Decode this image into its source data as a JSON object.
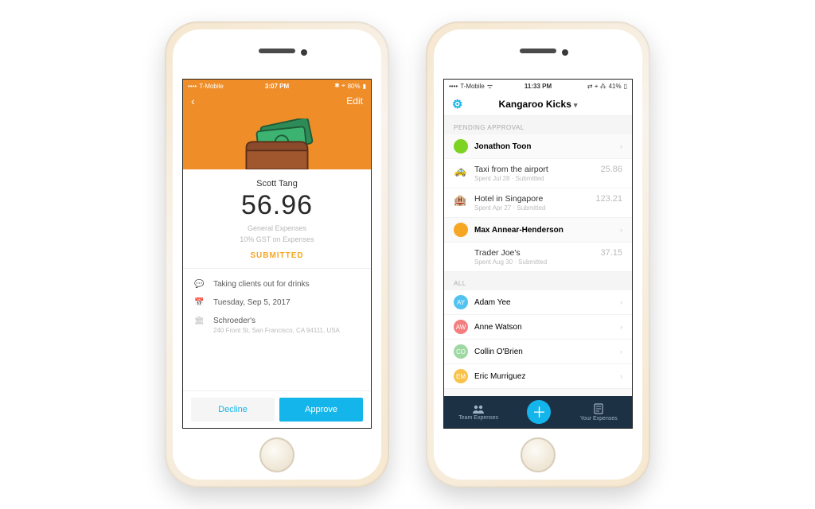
{
  "colors": {
    "accent": "#13b5ea",
    "header": "#ef8d29",
    "tabbar": "#1d3145",
    "warn": "#f5a623"
  },
  "phone1": {
    "status": {
      "carrier": "T-Mobile",
      "time": "3:07 PM",
      "battery": "80%"
    },
    "nav": {
      "edit": "Edit"
    },
    "amount": {
      "name": "Scott Tang",
      "value": "56.96",
      "category": "General Expenses",
      "gst": "10% GST on Expenses",
      "status": "SUBMITTED"
    },
    "details": {
      "note": "Taking clients out for drinks",
      "date": "Tuesday, Sep 5, 2017",
      "location_name": "Schroeder's",
      "location_addr": "240 Front St, San Francisco, CA 94111, USA"
    },
    "actions": {
      "decline": "Decline",
      "approve": "Approve"
    }
  },
  "phone2": {
    "status": {
      "carrier": "T-Mobile",
      "time": "11:33 PM",
      "battery": "41%"
    },
    "nav": {
      "title": "Kangaroo Kicks"
    },
    "sections": {
      "pending_hdr": "PENDING APPROVAL",
      "all_hdr": "ALL"
    },
    "pending": [
      {
        "name": "Jonathon Toon",
        "avatar_bg": "#7ed321"
      }
    ],
    "expenses": [
      {
        "icon": "taxi",
        "title": "Taxi from the airport",
        "meta": "Spent Jul 28 · Submitted",
        "amount": "25.86"
      },
      {
        "icon": "hotel",
        "title": "Hotel in Singapore",
        "meta": "Spent Apr 27 · Submitted",
        "amount": "123.21"
      }
    ],
    "pending2": [
      {
        "name": "Max Annear-Henderson",
        "avatar_bg": "#f6a623"
      }
    ],
    "expenses2": [
      {
        "icon": "",
        "title": "Trader Joe's",
        "meta": "Spent Aug 30 · Submitted",
        "amount": "37.15"
      }
    ],
    "all": [
      {
        "name": "Adam Yee",
        "avatar_bg": "#52c3f1",
        "initials": "AY"
      },
      {
        "name": "Anne Watson",
        "avatar_bg": "#f47e7e",
        "initials": "AW"
      },
      {
        "name": "Collin O'Brien",
        "avatar_bg": "#9fd8a3",
        "initials": "CO"
      },
      {
        "name": "Eric Murriguez",
        "avatar_bg": "#f8c24b",
        "initials": "EM"
      }
    ],
    "tabs": {
      "left": "Team Expenses",
      "right": "Your Expenses"
    }
  }
}
